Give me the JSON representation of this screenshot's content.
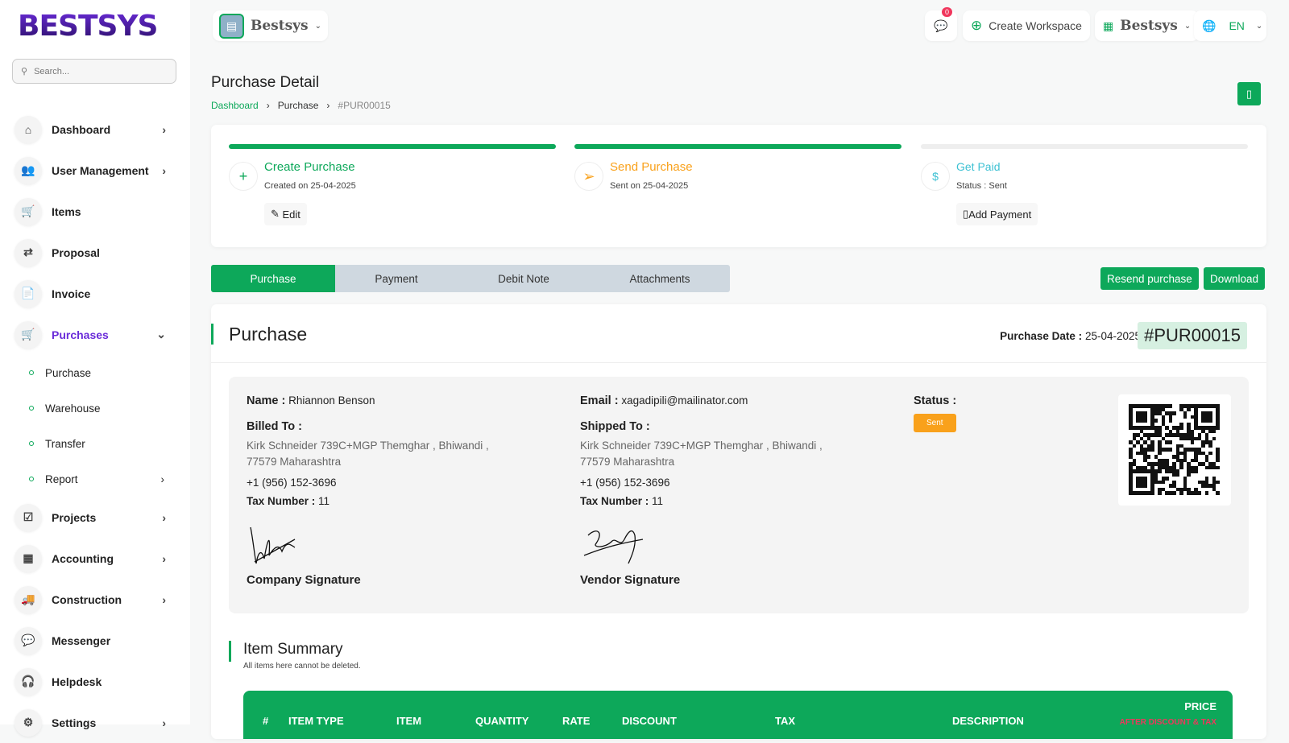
{
  "brand": "BESTSYS",
  "search": {
    "placeholder": "Search..."
  },
  "sidebar": {
    "items": [
      {
        "label": "Dashboard",
        "icon": "home-icon",
        "glyph": "⌂",
        "chev": "›"
      },
      {
        "label": "User Management",
        "icon": "users-icon",
        "glyph": "👥",
        "chev": "›"
      },
      {
        "label": "Items",
        "icon": "cart-icon",
        "glyph": "🛒",
        "chev": ""
      },
      {
        "label": "Proposal",
        "icon": "proposal-icon",
        "glyph": "⇄",
        "chev": ""
      },
      {
        "label": "Invoice",
        "icon": "invoice-icon",
        "glyph": "📄",
        "chev": ""
      },
      {
        "label": "Purchases",
        "icon": "cart-icon",
        "glyph": "🛒",
        "chev": "⌄"
      }
    ],
    "sub": [
      {
        "label": "Purchase"
      },
      {
        "label": "Warehouse"
      },
      {
        "label": "Transfer"
      },
      {
        "label": "Report",
        "chev": "›"
      }
    ],
    "items2": [
      {
        "label": "Projects",
        "icon": "check-square-icon",
        "glyph": "☑",
        "chev": "›"
      },
      {
        "label": "Accounting",
        "icon": "grid-icon",
        "glyph": "▦",
        "chev": "›"
      },
      {
        "label": "Construction",
        "icon": "truck-icon",
        "glyph": "🚚",
        "chev": "›"
      },
      {
        "label": "Messenger",
        "icon": "chat-icon",
        "glyph": "💬",
        "chev": ""
      },
      {
        "label": "Helpdesk",
        "icon": "headset-icon",
        "glyph": "🎧",
        "chev": ""
      },
      {
        "label": "Settings",
        "icon": "gear-icon",
        "glyph": "⚙",
        "chev": "›"
      }
    ]
  },
  "topbar": {
    "workspace": "Bestsys",
    "notif_count": "0",
    "create_workspace": "Create Workspace",
    "company": "Bestsys",
    "lang": "EN"
  },
  "header": {
    "title": "Purchase Detail",
    "breadcrumb": [
      "Dashboard",
      "Purchase",
      "#PUR00015"
    ]
  },
  "steps": [
    {
      "title": "Create Purchase",
      "sub": "Created on 25-04-2025",
      "button": "Edit",
      "color": "#0da85a"
    },
    {
      "title": "Send Purchase",
      "sub": "Sent on 25-04-2025",
      "color": "#f9a11b"
    },
    {
      "title": "Get Paid",
      "sub": "Status : Sent",
      "button": "Add Payment",
      "color": "#3ec1d3"
    }
  ],
  "tabs": [
    "Purchase",
    "Payment",
    "Debit Note",
    "Attachments"
  ],
  "actions": {
    "resend": "Resend purchase",
    "download": "Download"
  },
  "purchase": {
    "title": "Purchase",
    "date_label": "Purchase Date :",
    "date": "25-04-2025",
    "number": "#PUR00015",
    "name_label": "Name :",
    "name": "Rhiannon Benson",
    "email_label": "Email :",
    "email": "xagadipili@mailinator.com",
    "status_label": "Status :",
    "status": "Sent",
    "billed_label": "Billed To :",
    "shipped_label": "Shipped To :",
    "address1": "Kirk Schneider 739C+MGP Themghar , Bhiwandi ,",
    "address2": "77579 Maharashtra",
    "phone": "+1 (956) 152-3696",
    "tax_label": "Tax Number :",
    "tax": "11",
    "company_sig": "Company Signature",
    "vendor_sig": "Vendor Signature"
  },
  "summary": {
    "title": "Item Summary",
    "subtitle": "All items here cannot be deleted.",
    "columns": [
      "#",
      "ITEM TYPE",
      "ITEM",
      "QUANTITY",
      "RATE",
      "DISCOUNT",
      "TAX",
      "DESCRIPTION",
      "PRICE"
    ],
    "price_note": "AFTER DISCOUNT & TAX"
  }
}
